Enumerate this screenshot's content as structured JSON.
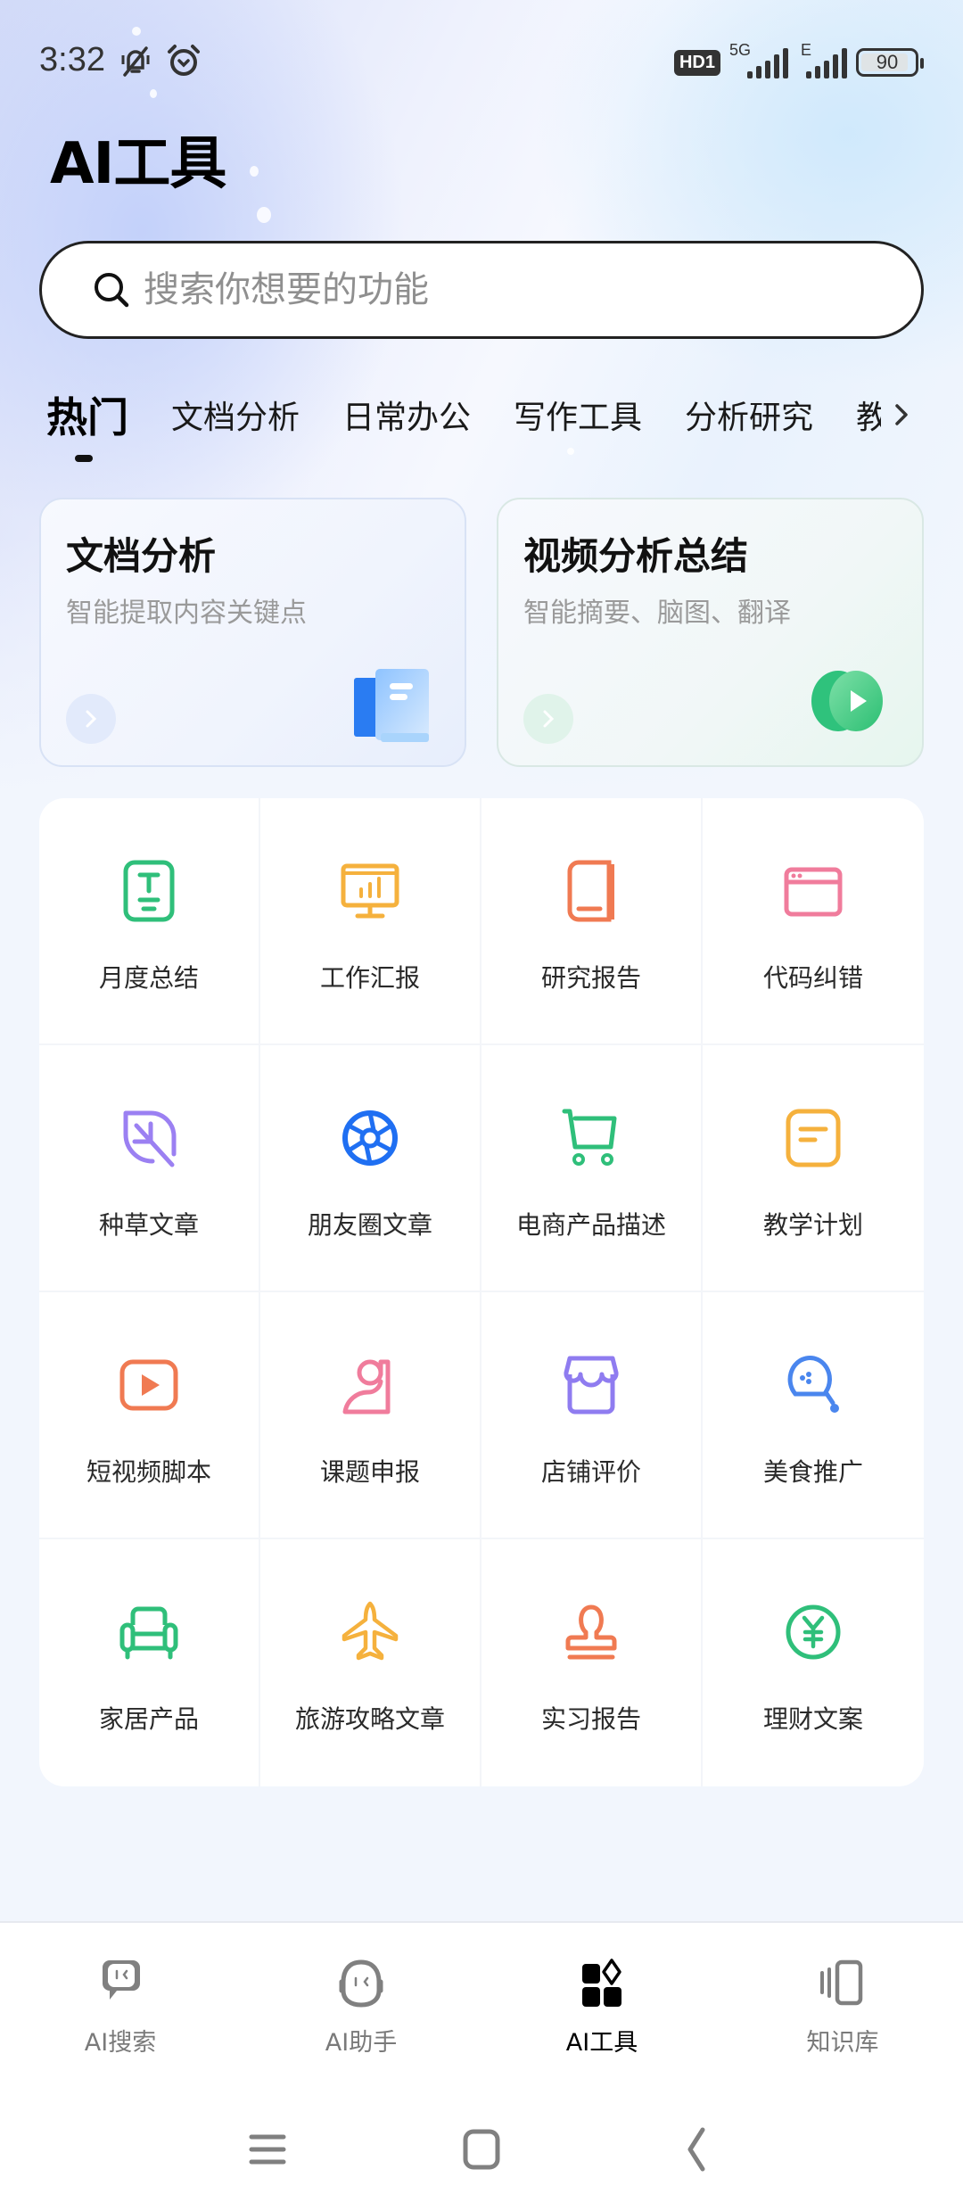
{
  "status_bar": {
    "time": "3:32",
    "left_icons": [
      "mute-icon",
      "alarm-icon"
    ],
    "hd_badge": "HD1",
    "signal_1_label": "5G",
    "signal_2_label": "E",
    "battery": "90",
    "battery_level": 0.9
  },
  "header": {
    "title": "AI工具"
  },
  "search": {
    "placeholder": "搜索你想要的功能",
    "value": ""
  },
  "tabs": [
    {
      "label": "热门",
      "active": true
    },
    {
      "label": "文档分析"
    },
    {
      "label": "日常办公"
    },
    {
      "label": "写作工具"
    },
    {
      "label": "分析研究"
    },
    {
      "label": "教"
    }
  ],
  "tabs_more_icon": "chevron-right-icon",
  "feature_cards": [
    {
      "title": "文档分析",
      "subtitle": "智能提取内容关键点",
      "icon": "document-stack-icon",
      "accent": "#2f7bf5"
    },
    {
      "title": "视频分析总结",
      "subtitle": "智能摘要、脑图、翻译",
      "icon": "play-coin-icon",
      "accent": "#2fc27c"
    }
  ],
  "tools": [
    {
      "label": "月度总结",
      "icon": "text-tablet-icon",
      "color": "#2fbf7a"
    },
    {
      "label": "工作汇报",
      "icon": "presentation-chart-icon",
      "color": "#f5b13d"
    },
    {
      "label": "研究报告",
      "icon": "book-icon",
      "color": "#f07a52"
    },
    {
      "label": "代码纠错",
      "icon": "browser-window-icon",
      "color": "#f07c9c"
    },
    {
      "label": "种草文章",
      "icon": "leaf-icon",
      "color": "#9b80f2"
    },
    {
      "label": "朋友圈文章",
      "icon": "aperture-icon",
      "color": "#1f6ff2"
    },
    {
      "label": "电商产品描述",
      "icon": "shopping-cart-icon",
      "color": "#2fbf7a"
    },
    {
      "label": "教学计划",
      "icon": "note-card-icon",
      "color": "#f5b13d"
    },
    {
      "label": "短视频脚本",
      "icon": "video-play-icon",
      "color": "#f07a52"
    },
    {
      "label": "课题申报",
      "icon": "person-desk-icon",
      "color": "#f07c9c"
    },
    {
      "label": "店铺评价",
      "icon": "storefront-icon",
      "color": "#8f7cf0"
    },
    {
      "label": "美食推广",
      "icon": "drumstick-icon",
      "color": "#4a86ee"
    },
    {
      "label": "家居产品",
      "icon": "armchair-icon",
      "color": "#2fbf7a"
    },
    {
      "label": "旅游攻略文章",
      "icon": "airplane-icon",
      "color": "#f5b13d"
    },
    {
      "label": "实习报告",
      "icon": "stamp-icon",
      "color": "#f07a52"
    },
    {
      "label": "理财文案",
      "icon": "yen-coin-icon",
      "color": "#2fbf7a"
    }
  ],
  "bottom_nav": [
    {
      "label": "AI搜索",
      "icon": "chat-bubble-face-icon"
    },
    {
      "label": "AI助手",
      "icon": "robot-face-icon"
    },
    {
      "label": "AI工具",
      "icon": "apps-grid-icon",
      "active": true
    },
    {
      "label": "知识库",
      "icon": "card-stack-icon"
    }
  ],
  "system_nav": [
    "menu-icon",
    "home-icon",
    "back-icon"
  ]
}
